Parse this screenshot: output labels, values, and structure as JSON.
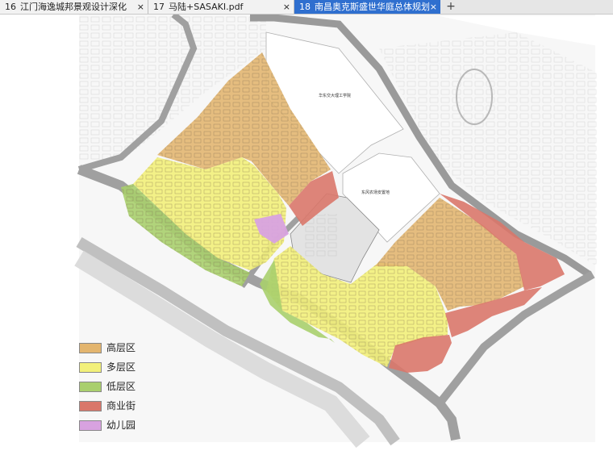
{
  "tabs": [
    {
      "num": "16",
      "title": "江门海逸城邦景观设计深化",
      "close": "×",
      "active": false
    },
    {
      "num": "17",
      "title": "马陆+SASAKI.pdf",
      "close": "×",
      "active": false
    },
    {
      "num": "18",
      "title": "南昌奥克斯盛世华庭总体规划",
      "close": "×",
      "active": true
    }
  ],
  "new_tab_label": "+",
  "map_labels": {
    "school": "华东交大理工学院",
    "site": "东风农场安置地"
  },
  "legend": [
    {
      "label": "高层区",
      "color": "#e3b56e"
    },
    {
      "label": "多层区",
      "color": "#f2f07a"
    },
    {
      "label": "低层区",
      "color": "#a9cf6d"
    },
    {
      "label": "商业街",
      "color": "#d9776a"
    },
    {
      "label": "幼儿园",
      "color": "#d8a2e0"
    }
  ],
  "zone_colors": {
    "high_rise": "#e3b56e",
    "multi_story": "#f2f07a",
    "low_rise": "#a9cf6d",
    "commercial": "#d9776a",
    "kindergarten": "#d8a2e0",
    "road": "#9c9c9c"
  }
}
